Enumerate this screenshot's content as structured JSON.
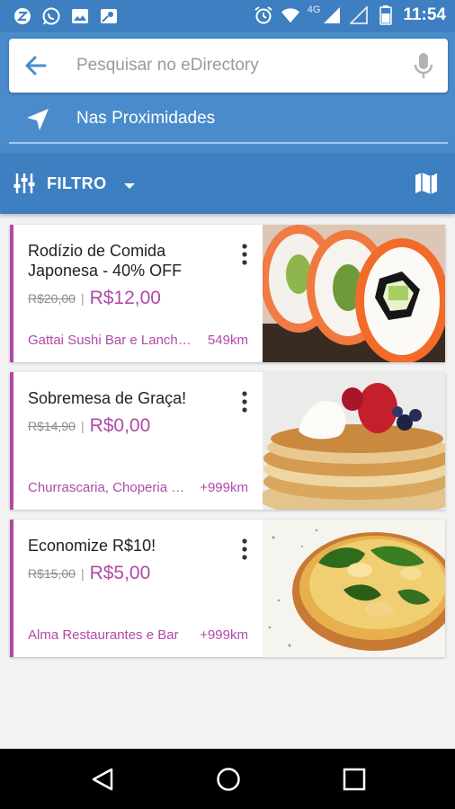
{
  "status_bar": {
    "network": "4G",
    "time": "11:54",
    "icons": [
      "z-app-icon",
      "whatsapp-icon",
      "gallery-icon",
      "maps-icon",
      "alarm-icon",
      "wifi-icon",
      "signal-icon",
      "signal-empty-icon",
      "battery-icon"
    ]
  },
  "search": {
    "placeholder": "Pesquisar no eDirectory"
  },
  "nearby": {
    "label": "Nas Proximidades"
  },
  "filter": {
    "label": "FILTRO"
  },
  "deals": [
    {
      "title": "Rodízio de Comida Japonesa - 40% OFF",
      "old_price": "R$20,00",
      "separator": "|",
      "new_price": "R$12,00",
      "merchant": "Gattai Sushi Bar e Lanchonete",
      "distance": "549km",
      "image": "sushi-photo"
    },
    {
      "title": "Sobremesa de Graça!",
      "old_price": "R$14,90",
      "separator": "|",
      "new_price": "R$0,00",
      "merchant": "Churrascaria, Choperia e Pizzaria",
      "distance": "+999km",
      "image": "pancakes-photo"
    },
    {
      "title": "Economize R$10!",
      "old_price": "R$15,00",
      "separator": "|",
      "new_price": "R$5,00",
      "merchant": "Alma Restaurantes e Bar",
      "distance": "+999km",
      "image": "pizza-photo"
    }
  ],
  "colors": {
    "header": "#4a8ccb",
    "filter_bar": "#3d7fc0",
    "accent": "#b04aa8"
  }
}
